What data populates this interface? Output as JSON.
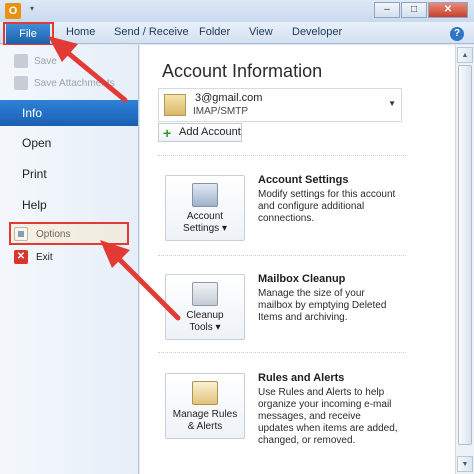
{
  "window": {
    "app_icon": "O",
    "qat_arrow": "▾",
    "minimize": "–",
    "maximize": "□",
    "close": "✕"
  },
  "ribbon": {
    "tabs": [
      "File",
      "Home",
      "Send / Receive",
      "Folder",
      "View",
      "Developer"
    ],
    "help": "?"
  },
  "nav": {
    "quick": [
      "Save",
      "Save Attachments"
    ],
    "items": [
      "Info",
      "Open",
      "Print",
      "Help"
    ],
    "sub_items": [
      "Options",
      "Exit"
    ],
    "exit_glyph": "✕"
  },
  "main": {
    "title": "Account Information",
    "account": {
      "email": "3@gmail.com",
      "type": "IMAP/SMTP",
      "arrow": "▼"
    },
    "add_account": "Add Account",
    "add_plus": "+",
    "features": [
      {
        "button_line1": "Account",
        "button_line2": "Settings ▾",
        "heading": "Account Settings",
        "description": "Modify settings for this account and configure additional connections."
      },
      {
        "button_line1": "Cleanup",
        "button_line2": "Tools ▾",
        "heading": "Mailbox Cleanup",
        "description": "Manage the size of your mailbox by emptying Deleted Items and archiving."
      },
      {
        "button_line1": "Manage Rules",
        "button_line2": "& Alerts",
        "heading": "Rules and Alerts",
        "description": "Use Rules and Alerts to help organize your incoming e-mail messages, and receive updates when items are added, changed, or removed."
      }
    ]
  },
  "scrollbar": {
    "up": "▲",
    "down": "▼"
  },
  "annotation_color": "#e23a35"
}
